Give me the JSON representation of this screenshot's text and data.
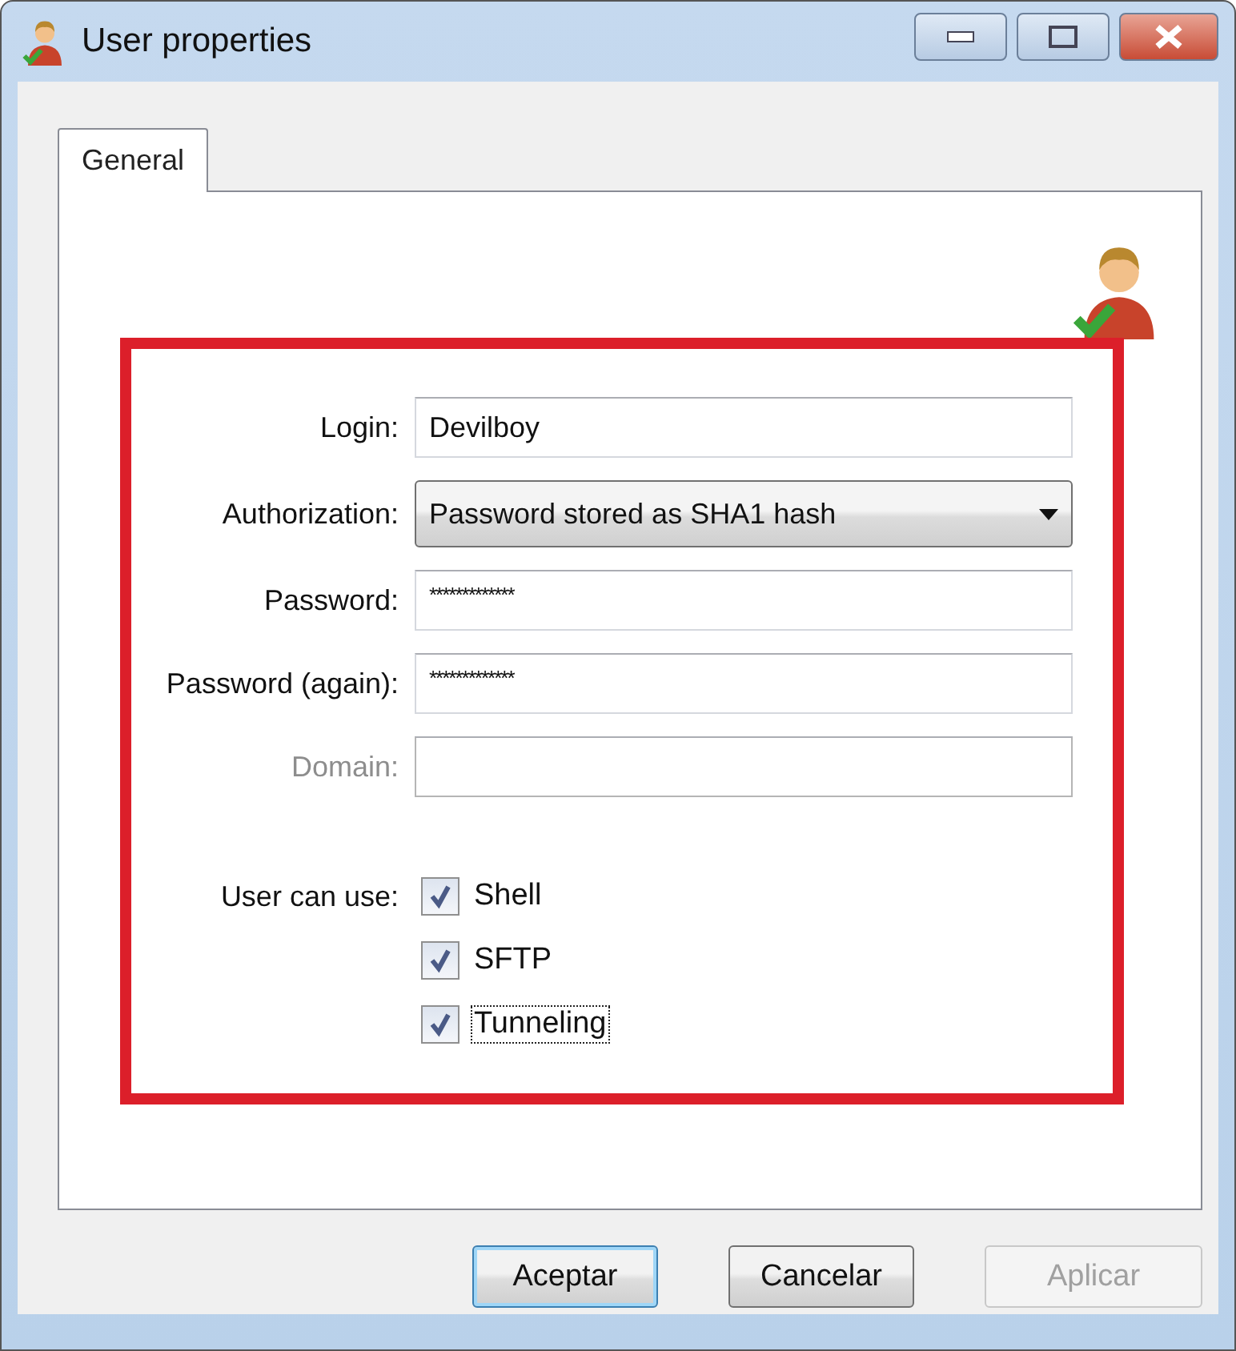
{
  "window": {
    "title": "User properties"
  },
  "tabs": [
    {
      "label": "General",
      "selected": true
    }
  ],
  "fields": [
    {
      "label": "Login:",
      "kind": "text",
      "value": "Devilboy",
      "disabled": false
    },
    {
      "label": "Authorization:",
      "kind": "select",
      "value": "Password stored as SHA1 hash",
      "disabled": false
    },
    {
      "label": "Password:",
      "kind": "password",
      "value": "*************",
      "disabled": false
    },
    {
      "label": "Password (again):",
      "kind": "password",
      "value": "*************",
      "disabled": false
    },
    {
      "label": "Domain:",
      "kind": "text",
      "disabled": true
    }
  ],
  "user_can_use": {
    "label": "User can use:",
    "options": [
      {
        "label": "Shell",
        "checked": true,
        "focused": false
      },
      {
        "label": "SFTP",
        "checked": true,
        "focused": false
      },
      {
        "label": "Tunneling",
        "checked": true,
        "focused": true
      }
    ]
  },
  "buttons": [
    {
      "label": "Aceptar",
      "default": true,
      "disabled": false
    },
    {
      "label": "Cancelar",
      "default": false,
      "disabled": false
    },
    {
      "label": "Aplicar",
      "default": false,
      "disabled": true
    }
  ]
}
